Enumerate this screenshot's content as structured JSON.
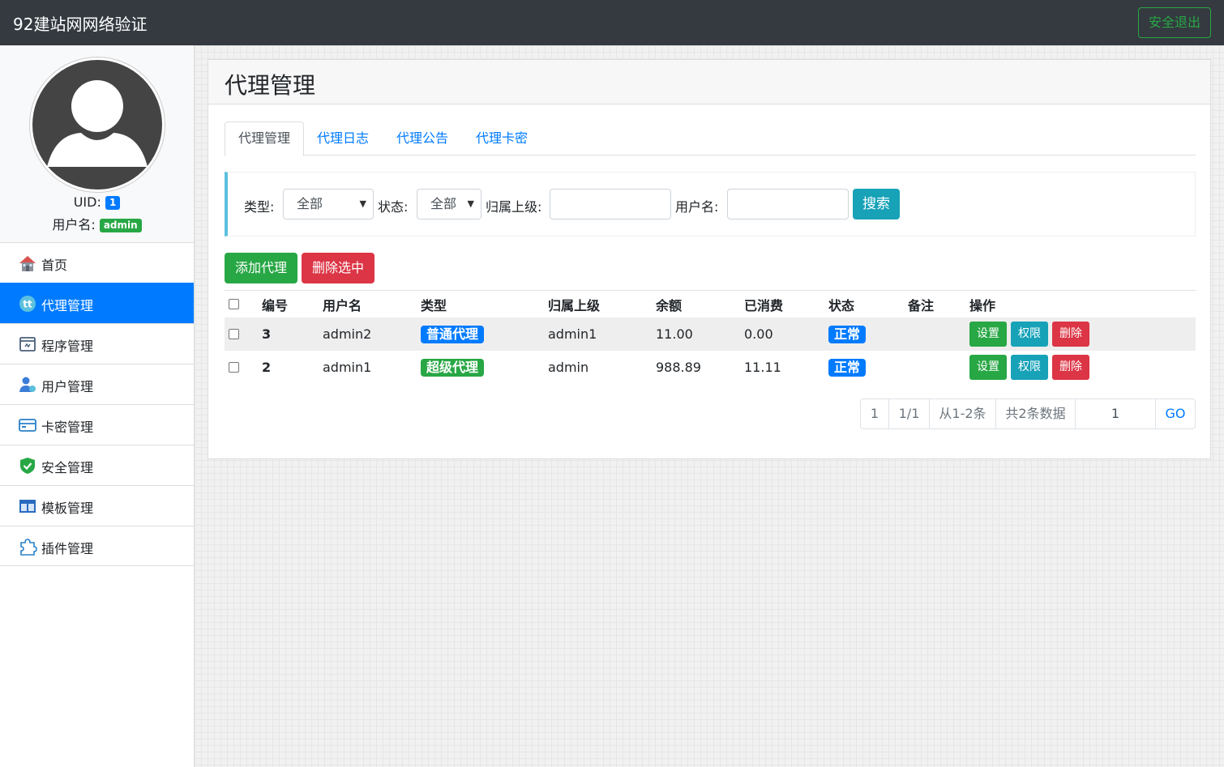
{
  "header": {
    "brand": "92建站网网络验证",
    "logout_label": "安全退出"
  },
  "profile": {
    "uid_label": "UID:",
    "uid_value": "1",
    "username_label": "用户名:",
    "username_value": "admin"
  },
  "nav": {
    "items": [
      {
        "label": "首页",
        "icon": "home-icon"
      },
      {
        "label": "代理管理",
        "icon": "agent-icon",
        "active": true
      },
      {
        "label": "程序管理",
        "icon": "program-icon"
      },
      {
        "label": "用户管理",
        "icon": "user-icon"
      },
      {
        "label": "卡密管理",
        "icon": "card-icon"
      },
      {
        "label": "安全管理",
        "icon": "shield-icon"
      },
      {
        "label": "模板管理",
        "icon": "template-icon"
      },
      {
        "label": "插件管理",
        "icon": "puzzle-icon"
      }
    ]
  },
  "main": {
    "title": "代理管理",
    "tabs": [
      {
        "label": "代理管理",
        "active": true
      },
      {
        "label": "代理日志"
      },
      {
        "label": "代理公告"
      },
      {
        "label": "代理卡密"
      }
    ],
    "search": {
      "type_label": "类型:",
      "type_value": "全部",
      "status_label": "状态:",
      "status_value": "全部",
      "parent_label": "归属上级:",
      "parent_value": "",
      "username_label": "用户名:",
      "username_value": "",
      "search_label": "搜索"
    },
    "actions": {
      "add_label": "添加代理",
      "delete_selected_label": "删除选中"
    },
    "table": {
      "headers": [
        "编号",
        "用户名",
        "类型",
        "归属上级",
        "余额",
        "已消费",
        "状态",
        "备注",
        "操作"
      ],
      "rows": [
        {
          "id": "3",
          "username": "admin2",
          "type": "普通代理",
          "type_color": "#007bff",
          "parent": "admin1",
          "balance": "11.00",
          "spent": "0.00",
          "status": "正常",
          "remark": ""
        },
        {
          "id": "2",
          "username": "admin1",
          "type": "超级代理",
          "type_color": "#28a745",
          "parent": "admin",
          "balance": "988.89",
          "spent": "11.11",
          "status": "正常",
          "remark": ""
        }
      ],
      "op_labels": {
        "set": "设置",
        "perm": "权限",
        "delete": "删除"
      }
    },
    "pager": {
      "current": "1",
      "pages": "1/1",
      "range": "从1-2条",
      "total": "共2条数据",
      "goto_value": "1",
      "go_label": "GO"
    }
  },
  "colors": {
    "primary": "#007bff",
    "success": "#28a745",
    "danger": "#dc3545",
    "info": "#17a2b8",
    "topbar": "#343a40"
  }
}
